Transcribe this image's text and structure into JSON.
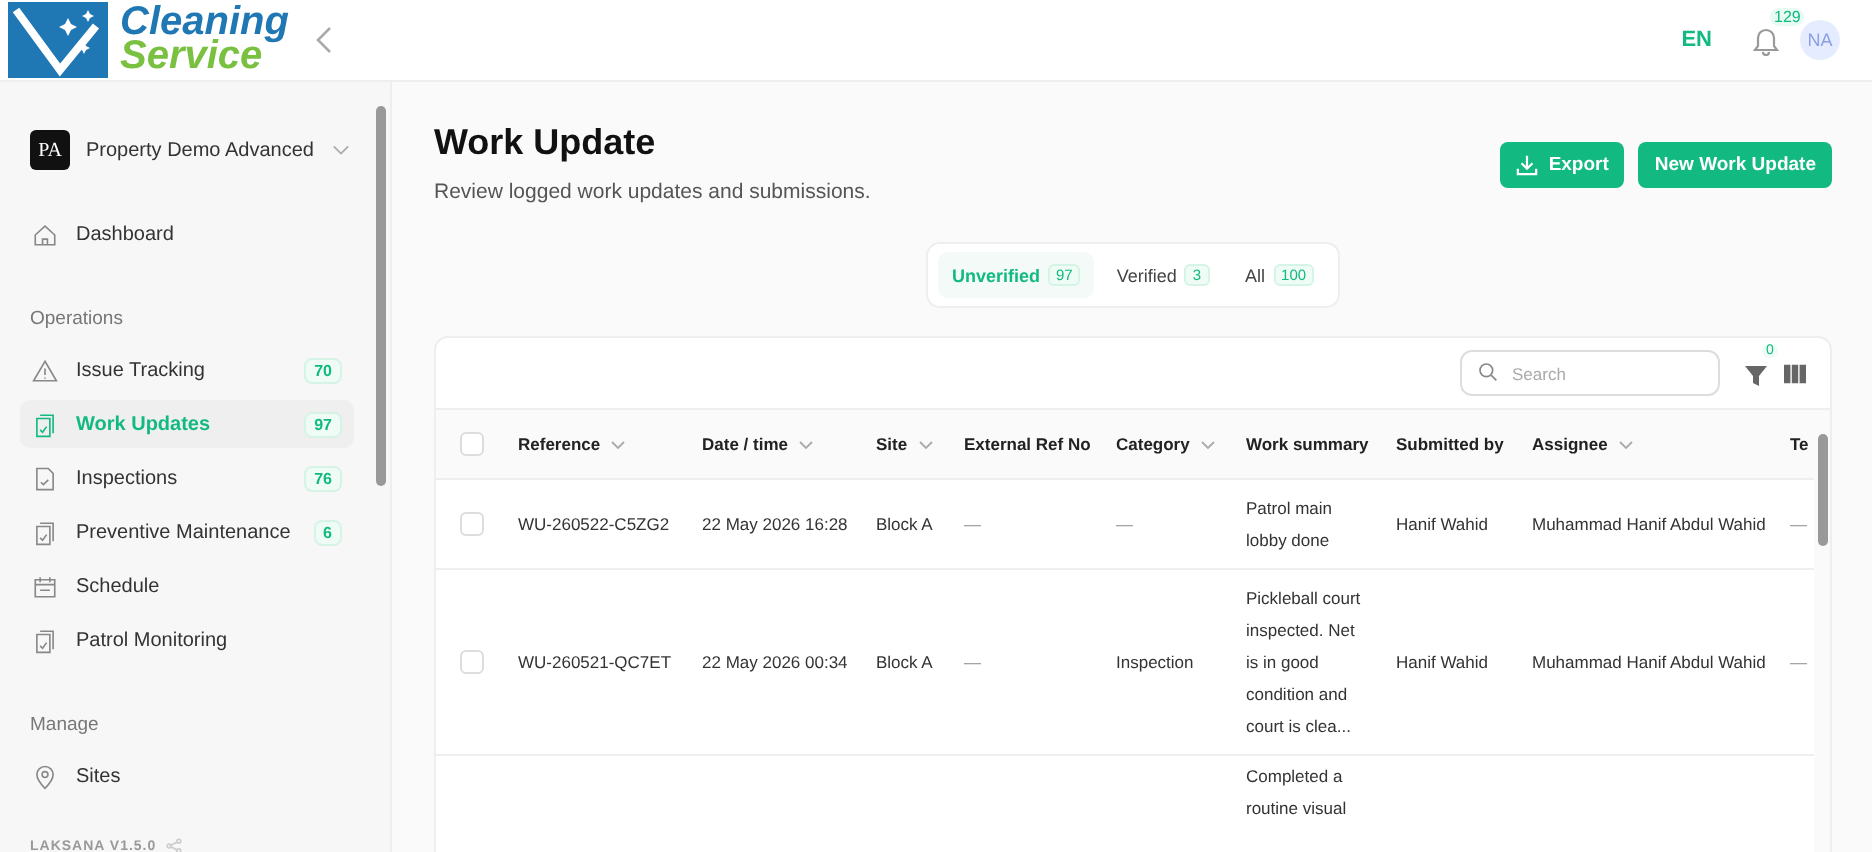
{
  "header": {
    "logo": {
      "line1": "Cleaning",
      "line2": "Service"
    },
    "language": "EN",
    "notification_count": "129",
    "avatar": "NA"
  },
  "sidebar": {
    "property": {
      "initials": "PA",
      "name": "Property Demo Advanced"
    },
    "groups": [
      {
        "items": [
          {
            "label": "Dashboard",
            "kind": "home",
            "selected": false
          }
        ]
      },
      {
        "title": "Operations",
        "items": [
          {
            "label": "Issue Tracking",
            "kind": "warning",
            "count": "70",
            "selected": false
          },
          {
            "label": "Work Updates",
            "kind": "clipboard",
            "count": "97",
            "selected": true
          },
          {
            "label": "Inspections",
            "kind": "document",
            "count": "76",
            "selected": false
          },
          {
            "label": "Preventive Maintenance",
            "kind": "clipboard",
            "count": "6",
            "selected": false
          },
          {
            "label": "Schedule",
            "kind": "calendar",
            "selected": false
          },
          {
            "label": "Patrol Monitoring",
            "kind": "clipboard",
            "selected": false
          }
        ]
      },
      {
        "title": "Manage",
        "items": [
          {
            "label": "Sites",
            "kind": "pin",
            "selected": false
          }
        ]
      }
    ],
    "version": "LAKSANA V1.5.0"
  },
  "page": {
    "title": "Work Update",
    "subtitle": "Review logged work updates and submissions.",
    "buttons": [
      {
        "label": "Export",
        "kind": "export"
      },
      {
        "label": "New Work Update",
        "kind": "primary"
      }
    ]
  },
  "filter_tabs": [
    {
      "label": "Unverified",
      "count": "97",
      "selected": true
    },
    {
      "label": "Verified",
      "count": "3",
      "selected": false
    },
    {
      "label": "All",
      "count": "100",
      "selected": false
    }
  ],
  "table": {
    "search": {
      "placeholder": "Search"
    },
    "filter_count": "0",
    "select_all_checked": false,
    "columns": [
      {
        "label": "Reference",
        "sortable": true
      },
      {
        "label": "Date / time",
        "sortable": true
      },
      {
        "label": "Site",
        "sortable": true
      },
      {
        "label": "External Ref No"
      },
      {
        "label": "Category",
        "sortable": true
      },
      {
        "label": "Work summary"
      },
      {
        "label": "Submitted by"
      },
      {
        "label": "Assignee",
        "sortable": true
      },
      {
        "label": "Te"
      }
    ],
    "rows": [
      {
        "checked": false,
        "cells": [
          "WU-260522-C5ZG2",
          "22 May 2026 16:28",
          "Block A",
          "—",
          "—",
          "Patrol main lobby done",
          "Hanif Wahid",
          "Muhammad Hanif Abdul Wahid",
          "—"
        ]
      },
      {
        "checked": false,
        "cells": [
          "WU-260521-QC7ET",
          "22 May 2026 00:34",
          "Block A",
          "—",
          "Inspection",
          "Pickleball court inspected. Net is in good condition and court is clea...",
          "Hanif Wahid",
          "Muhammad Hanif Abdul Wahid",
          "—"
        ]
      }
    ],
    "cut_off_row": {
      "summary": "Completed a routine visual"
    }
  }
}
